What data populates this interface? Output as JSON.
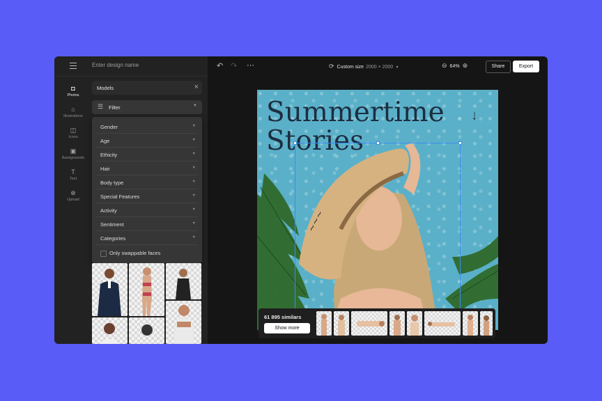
{
  "header": {
    "design_name_placeholder": "Enter design name"
  },
  "rail": [
    {
      "label": "Photos",
      "icon": "photos-icon"
    },
    {
      "label": "Illustrations",
      "icon": "illustrations-icon"
    },
    {
      "label": "Icons",
      "icon": "icons-icon"
    },
    {
      "label": "Backgrounds",
      "icon": "backgrounds-icon"
    },
    {
      "label": "Text",
      "icon": "text-icon"
    },
    {
      "label": "Upload",
      "icon": "upload-icon"
    }
  ],
  "panel": {
    "search_value": "Models",
    "filter_label": "Filter",
    "filter_items": [
      "Gender",
      "Age",
      "Ethicity",
      "Hair",
      "Body type",
      "Special Features",
      "Activity",
      "Sentiment",
      "Categories"
    ],
    "swappable_label": "Only swappable faces"
  },
  "toolbar": {
    "size_label": "Custom size",
    "size_dims": "2000 × 2000",
    "zoom": "64%",
    "share_label": "Share",
    "export_label": "Export"
  },
  "canvas": {
    "headline_line1": "Summertime",
    "headline_line2": "Stories",
    "background_color": "#5ab0c8"
  },
  "similars": {
    "count_label": "61 895 similars",
    "show_more_label": "Show more"
  },
  "colors": {
    "app_background": "#5a5cf8",
    "selection": "#3a8df0",
    "headline": "#1d2d40"
  }
}
